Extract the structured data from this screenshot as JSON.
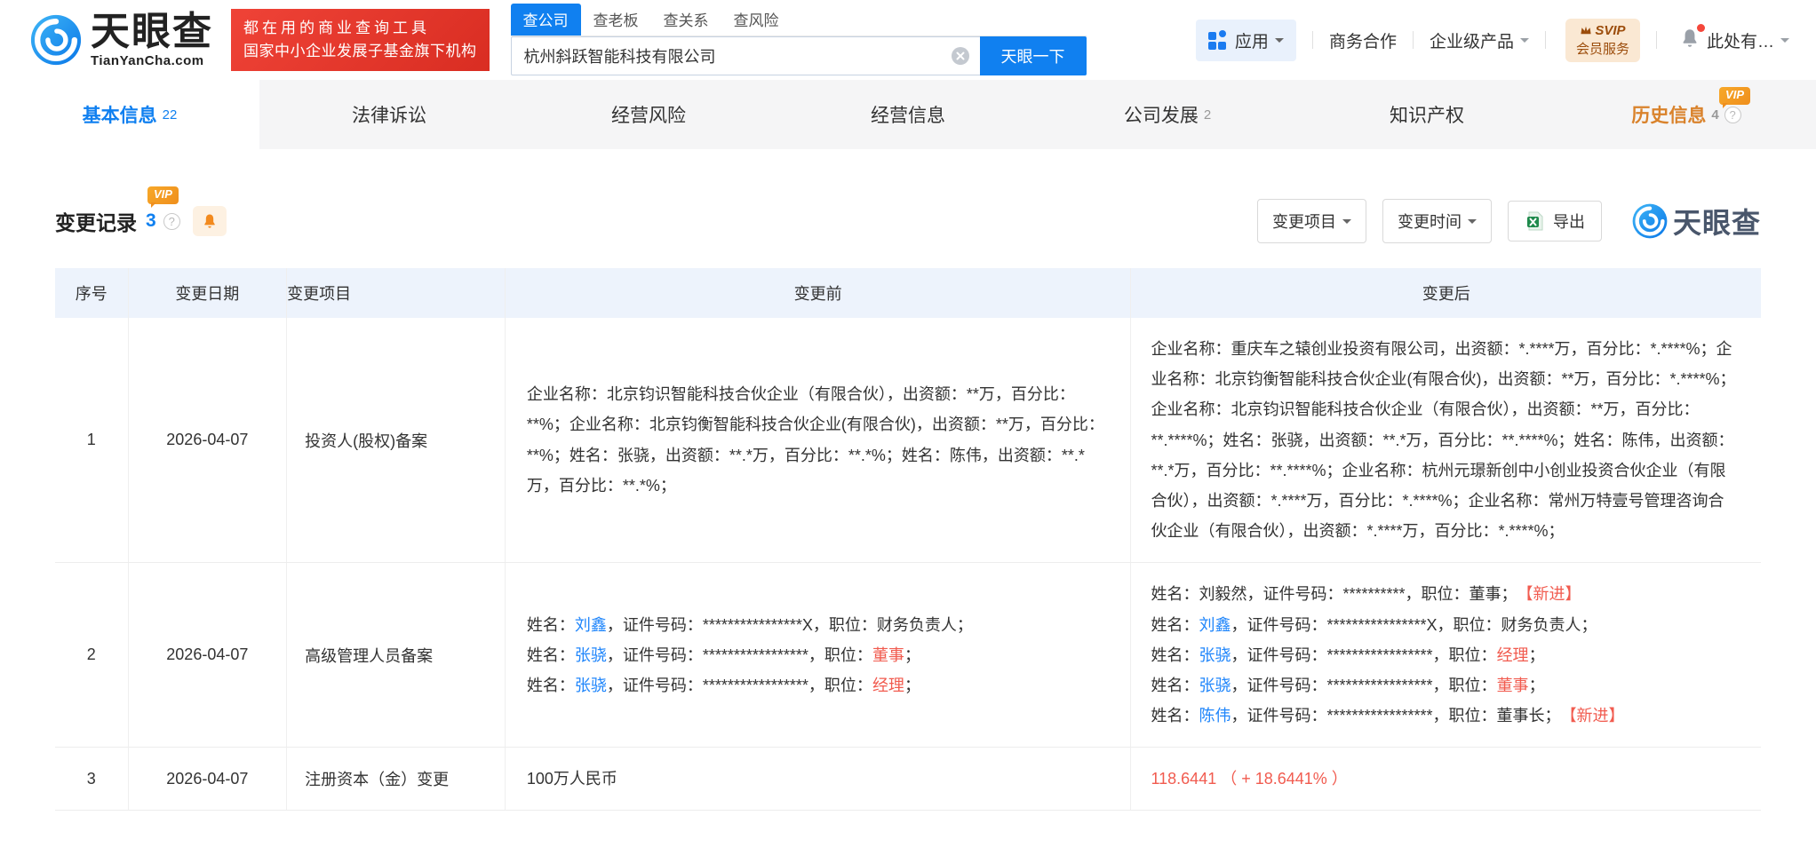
{
  "badges": {
    "vip": "VIP"
  },
  "icons": {
    "help": "?"
  },
  "colors": {
    "brand_blue": "#1080f0",
    "link_blue": "#2086fb",
    "alert_red": "#f15b4f",
    "orange": "#d9822b",
    "promo_red": "#e23c30",
    "table_header_bg": "#edf3fc"
  },
  "header": {
    "logo": {
      "title": "天眼查",
      "domain": "TianYanCha.com"
    },
    "promo": {
      "line1": "都在用的商业查询工具",
      "line2": "国家中小企业发展子基金旗下机构"
    },
    "search": {
      "tabs": [
        {
          "label": "查公司",
          "active": true
        },
        {
          "label": "查老板",
          "active": false
        },
        {
          "label": "查关系",
          "active": false
        },
        {
          "label": "查风险",
          "active": false
        }
      ],
      "input_value": "杭州斜跃智能科技有限公司",
      "button_label": "天眼一下"
    },
    "nav": {
      "apps_label": "应用",
      "link_cooperation": "商务合作",
      "link_enterprise": "企业级产品",
      "svip_line1": "SVIP",
      "svip_line2": "会员服务",
      "user_label": "此处有…"
    }
  },
  "tabs": [
    {
      "label": "基本信息",
      "count": "22",
      "active": true
    },
    {
      "label": "法律诉讼"
    },
    {
      "label": "经营风险"
    },
    {
      "label": "经营信息"
    },
    {
      "label": "公司发展",
      "count": "2"
    },
    {
      "label": "知识产权"
    },
    {
      "label": "历史信息",
      "count": "4",
      "orange": true,
      "vip": true,
      "help": true
    }
  ],
  "section": {
    "title": "变更记录",
    "count": "3",
    "filter_item_label": "变更项目",
    "filter_time_label": "变更时间",
    "export_label": "导出",
    "watermark": "天眼查"
  },
  "table": {
    "columns": [
      "序号",
      "变更日期",
      "变更项目",
      "变更前",
      "变更后"
    ],
    "rows": [
      {
        "no": "1",
        "date": "2026-04-07",
        "item": "投资人(股权)备案",
        "before": [
          [
            {
              "t": "企业名称：北京钧识智能科技合伙企业（有限合伙），出资额：**万，百分比：**%；企业名称：北京钧衡智能科技合伙企业(有限合伙)，出资额：**万，百分比：**%；姓名：张骁，出资额：**.*万，百分比：**.*%；姓名：陈伟，出资额：**.*万，百分比：**.*%；"
            }
          ]
        ],
        "after": [
          [
            {
              "t": "企业名称：重庆车之辕创业投资有限公司，出资额：*.****万，百分比：*.****%；企业名称：北京钧衡智能科技合伙企业(有限合伙)，出资额：**万，百分比：*.****%；企业名称：北京钧识智能科技合伙企业（有限合伙），出资额：**万，百分比：**.****%；姓名：张骁，出资额：**.*万，百分比：**.****%；姓名：陈伟，出资额：**.*万，百分比：**.****%；企业名称：杭州元璟新创中小创业投资合伙企业（有限合伙），出资额：*.****万，百分比：*.****%；企业名称：常州万特壹号管理咨询合伙企业（有限合伙），出资额：*.****万，百分比：*.****%；"
            }
          ]
        ]
      },
      {
        "no": "2",
        "date": "2026-04-07",
        "item": "高级管理人员备案",
        "before": [
          [
            {
              "t": "姓名："
            },
            {
              "t": "刘鑫",
              "s": "link"
            },
            {
              "t": "，证件号码：****************X，职位：财务负责人；"
            }
          ],
          [
            {
              "t": "姓名："
            },
            {
              "t": "张骁",
              "s": "link"
            },
            {
              "t": "，证件号码：*****************，职位："
            },
            {
              "t": "董事",
              "s": "red"
            },
            {
              "t": "；"
            }
          ],
          [
            {
              "t": "姓名："
            },
            {
              "t": "张骁",
              "s": "link"
            },
            {
              "t": "，证件号码：*****************，职位："
            },
            {
              "t": "经理",
              "s": "red"
            },
            {
              "t": "；"
            }
          ]
        ],
        "after": [
          [
            {
              "t": "姓名：刘毅然，证件号码：**********，职位：董事；　"
            },
            {
              "t": "【新进】",
              "s": "red"
            }
          ],
          [
            {
              "t": "姓名："
            },
            {
              "t": "刘鑫",
              "s": "link"
            },
            {
              "t": "，证件号码：****************X，职位：财务负责人；"
            }
          ],
          [
            {
              "t": "姓名："
            },
            {
              "t": "张骁",
              "s": "link"
            },
            {
              "t": "，证件号码：*****************，职位："
            },
            {
              "t": "经理",
              "s": "red"
            },
            {
              "t": "；"
            }
          ],
          [
            {
              "t": "姓名："
            },
            {
              "t": "张骁",
              "s": "link"
            },
            {
              "t": "，证件号码：*****************，职位："
            },
            {
              "t": "董事",
              "s": "red"
            },
            {
              "t": "；"
            }
          ],
          [
            {
              "t": "姓名："
            },
            {
              "t": "陈伟",
              "s": "link"
            },
            {
              "t": "，证件号码：*****************，职位：董事长；　"
            },
            {
              "t": "【新进】",
              "s": "red"
            }
          ]
        ]
      },
      {
        "no": "3",
        "date": "2026-04-07",
        "item": "注册资本（金）变更",
        "before": [
          [
            {
              "t": "100万人民币"
            }
          ]
        ],
        "after": [
          [
            {
              "t": "118.6441 （ + 18.6441% ）",
              "s": "red"
            }
          ]
        ]
      }
    ]
  }
}
